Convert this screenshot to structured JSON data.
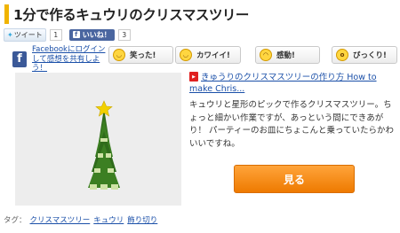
{
  "article": {
    "title": "1分で作るキュウリのクリスマスツリー"
  },
  "share": {
    "tweet_label": "ツイート",
    "tweet_count": "1",
    "fb_like_label": "いいね！",
    "fb_like_count": "3"
  },
  "facebook_login": {
    "text": "Facebookにログインして感想を共有しよう！"
  },
  "reactions": [
    {
      "label": "笑った!",
      "icon": "laughing-face-icon"
    },
    {
      "label": "カワイイ!",
      "icon": "smiling-face-icon"
    },
    {
      "label": "感動!",
      "icon": "moved-face-icon"
    },
    {
      "label": "びっくり!",
      "icon": "surprised-face-icon"
    }
  ],
  "video": {
    "link_text": "きゅうりのクリスマスツリーの作り方 How to make Chris...",
    "description": "キュウリと星形のピックで作るクリスマスツリー。ちょっと細かい作業ですが、あっという間にできあがり！ パーティーのお皿にちょこんと乗っていたらかわいいですね。",
    "view_button": "見る"
  },
  "tags": {
    "prefix": "タグ：",
    "items": [
      "クリスマスツリー",
      "キュウリ",
      "飾り切り"
    ]
  },
  "colors": {
    "accent": "#f0b400",
    "link": "#1a4fa8",
    "button": "#f08a18",
    "facebook": "#3b5998"
  }
}
